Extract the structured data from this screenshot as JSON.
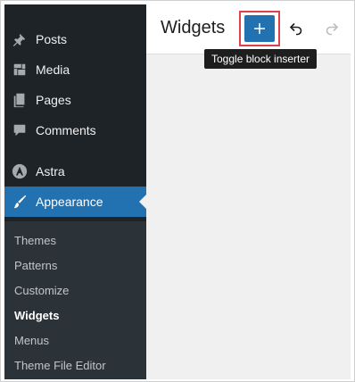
{
  "sidebar": {
    "items": [
      {
        "label": "Posts",
        "icon": "pushpin-icon"
      },
      {
        "label": "Media",
        "icon": "media-icon"
      },
      {
        "label": "Pages",
        "icon": "pages-icon"
      },
      {
        "label": "Comments",
        "icon": "comment-icon"
      },
      {
        "label": "Astra",
        "icon": "astra-icon"
      },
      {
        "label": "Appearance",
        "icon": "paintbrush-icon",
        "active": true
      }
    ],
    "submenu": [
      {
        "label": "Themes"
      },
      {
        "label": "Patterns"
      },
      {
        "label": "Customize"
      },
      {
        "label": "Widgets",
        "current": true
      },
      {
        "label": "Menus"
      },
      {
        "label": "Theme File Editor"
      }
    ]
  },
  "header": {
    "title": "Widgets",
    "inserter_icon": "plus-icon",
    "undo_icon": "undo-icon",
    "redo_icon": "redo-icon"
  },
  "tooltip": {
    "text": "Toggle block inserter"
  },
  "colors": {
    "sidebar_bg": "#1d2327",
    "submenu_bg": "#2c3338",
    "accent": "#2271b1",
    "highlight": "#e0404a"
  }
}
